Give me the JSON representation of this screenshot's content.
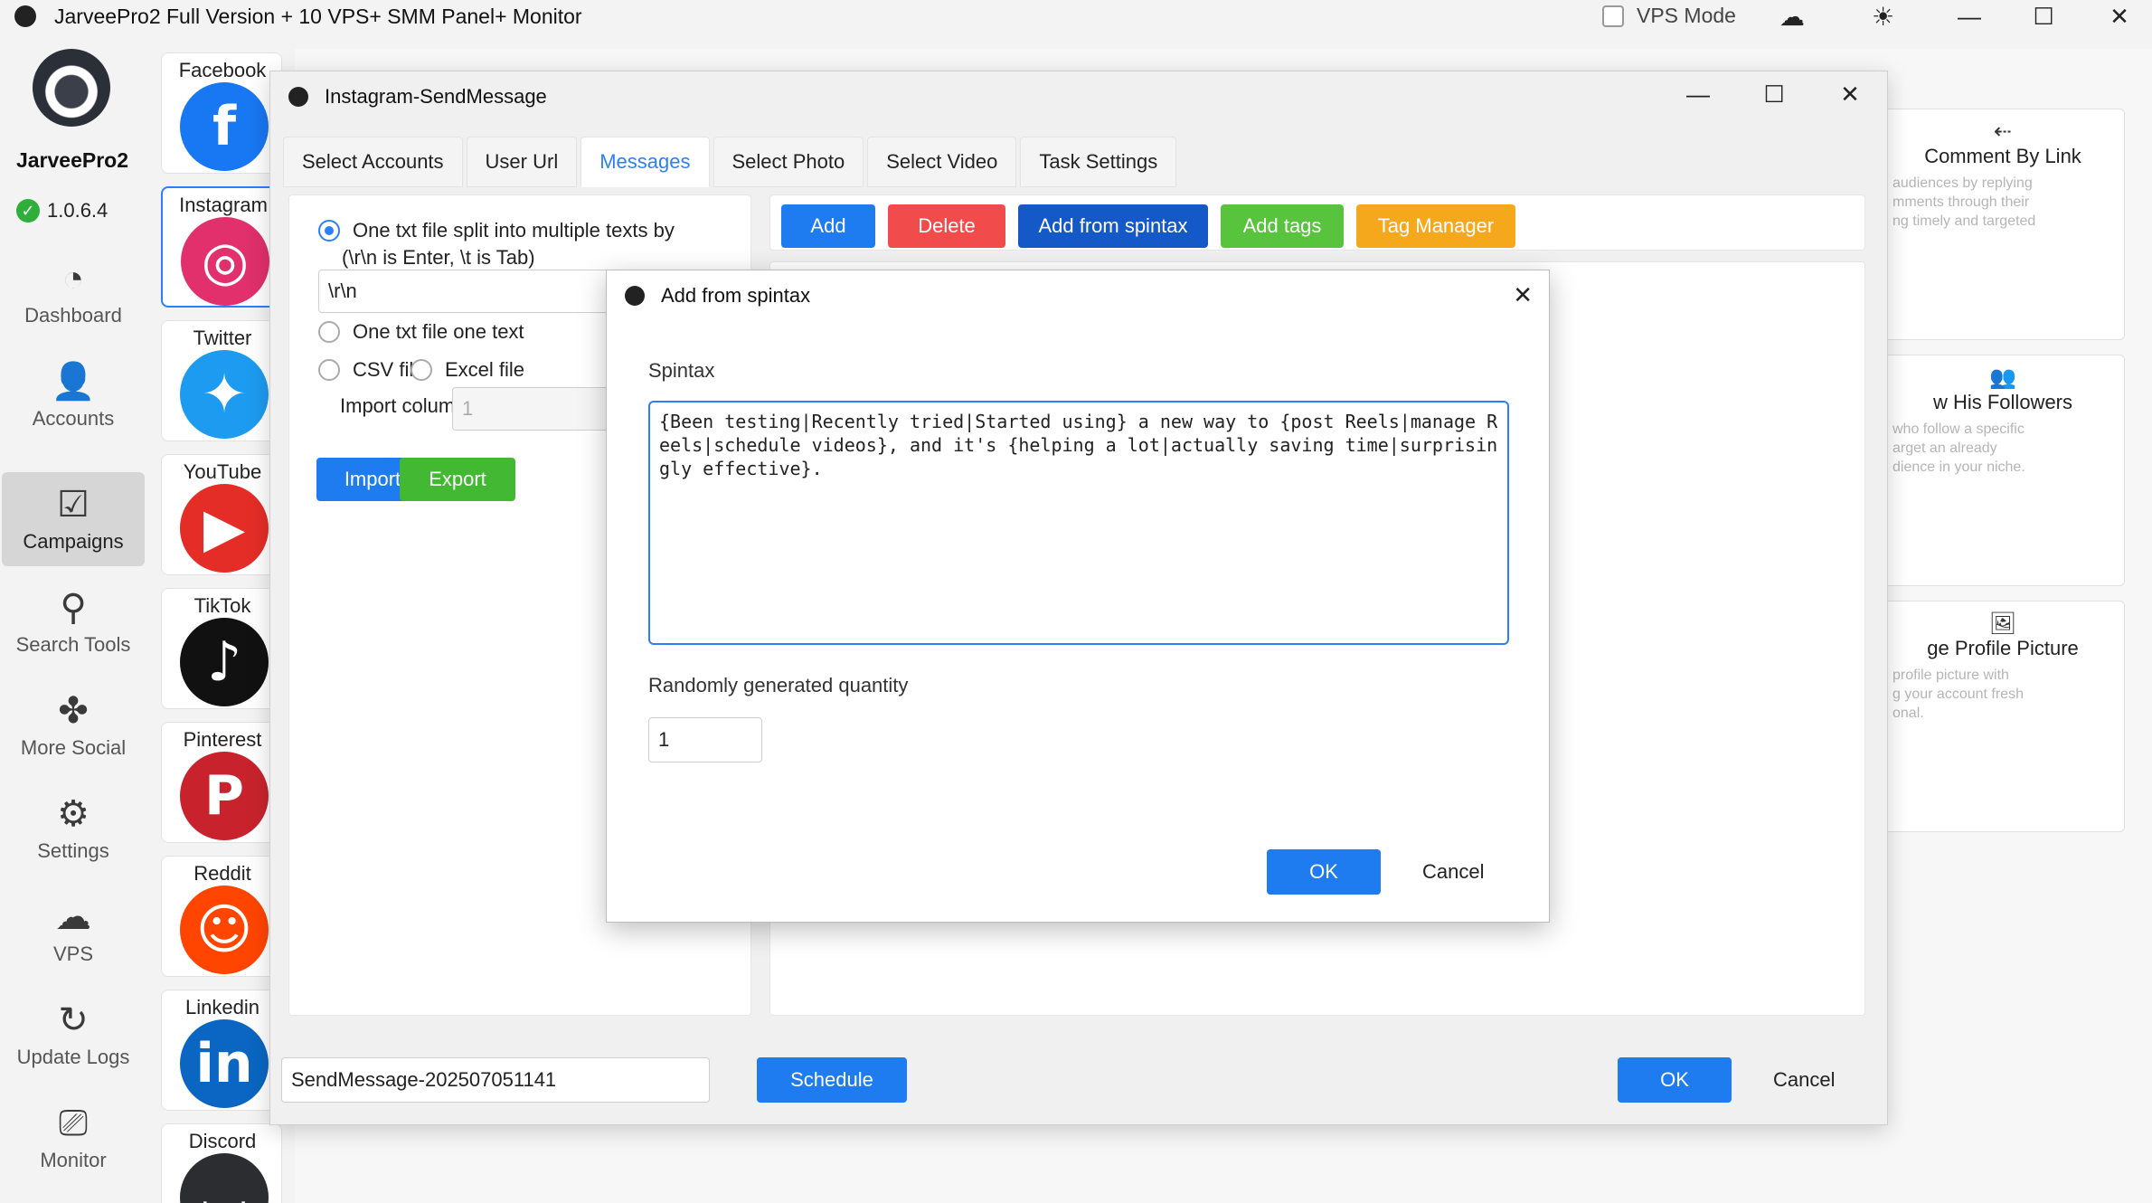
{
  "app": {
    "title": "JarveePro2 Full Version + 10 VPS+ SMM Panel+ Monitor",
    "vps_mode_label": "VPS Mode",
    "brand": "JarveePro2",
    "version": "1.0.6.4"
  },
  "nav": [
    {
      "label": "Dashboard",
      "icon": "◔"
    },
    {
      "label": "Accounts",
      "icon": "👤"
    },
    {
      "label": "Campaigns",
      "icon": "☑"
    },
    {
      "label": "Search Tools",
      "icon": "⚲"
    },
    {
      "label": "More Social",
      "icon": "✤"
    },
    {
      "label": "Settings",
      "icon": "⚙"
    },
    {
      "label": "VPS",
      "icon": "☁"
    },
    {
      "label": "Update Logs",
      "icon": "↻"
    },
    {
      "label": "Monitor",
      "icon": "⎚"
    }
  ],
  "social": [
    {
      "label": "Facebook",
      "glyph": "f",
      "color": "#1877f2"
    },
    {
      "label": "Instagram",
      "glyph": "◎",
      "color": "#e1306c"
    },
    {
      "label": "Twitter",
      "glyph": "✦",
      "color": "#1d9bf0"
    },
    {
      "label": "YouTube",
      "glyph": "▶",
      "color": "#e52d27"
    },
    {
      "label": "TikTok",
      "glyph": "♪",
      "color": "#111111"
    },
    {
      "label": "Pinterest",
      "glyph": "P",
      "color": "#c8232c"
    },
    {
      "label": "Reddit",
      "glyph": "☺",
      "color": "#ff4500"
    },
    {
      "label": "Linkedin",
      "glyph": "in",
      "color": "#0a66c2"
    },
    {
      "label": "Discord",
      "glyph": "◡",
      "color": "#2b2d31"
    }
  ],
  "background_cards": [
    {
      "title": "Comment  By  Link",
      "desc": "audiences by replying\nmments through their\nng timely and targeted",
      "icon": "⇠"
    },
    {
      "title": "w  His  Followers",
      "desc": "who follow a specific\narget an already\ndience in your niche.",
      "icon": "👥"
    },
    {
      "title": "ge  Profile  Picture",
      "desc": "profile picture with\ng your account fresh\nonal.",
      "icon": "🖼"
    }
  ],
  "main_window": {
    "title": "Instagram-SendMessage",
    "tabs": [
      "Select Accounts",
      "User Url",
      "Messages",
      "Select Photo",
      "Select Video",
      "Task Settings"
    ],
    "active_tab": "Messages",
    "options": {
      "split_label": "One txt file split into multiple texts by",
      "split_hint": "(\\r\\n is Enter, \\t is Tab)",
      "split_value": "\\r\\n",
      "one_text_label": "One txt file one text",
      "csv_label": "CSV file",
      "excel_label": "Excel file",
      "import_column_label": "Import column",
      "import_column_value": "1",
      "import_button": "Import",
      "export_button": "Export"
    },
    "toolbar": {
      "add": "Add",
      "delete": "Delete",
      "add_from_spintax": "Add from spintax",
      "add_tags": "Add tags",
      "tag_manager": "Tag Manager"
    },
    "bottom": {
      "task_name": "SendMessage-202507051141",
      "schedule": "Schedule",
      "ok": "OK",
      "cancel": "Cancel"
    }
  },
  "modal": {
    "title": "Add from spintax",
    "spintax_label": "Spintax",
    "spintax_value": "{Been testing|Recently tried|Started using} a new way to {post Reels|manage Reels|schedule videos}, and it's {helping a lot|actually saving time|surprisingly effective}.",
    "quantity_label": "Randomly generated quantity",
    "quantity_value": "1",
    "ok": "OK",
    "cancel": "Cancel"
  }
}
